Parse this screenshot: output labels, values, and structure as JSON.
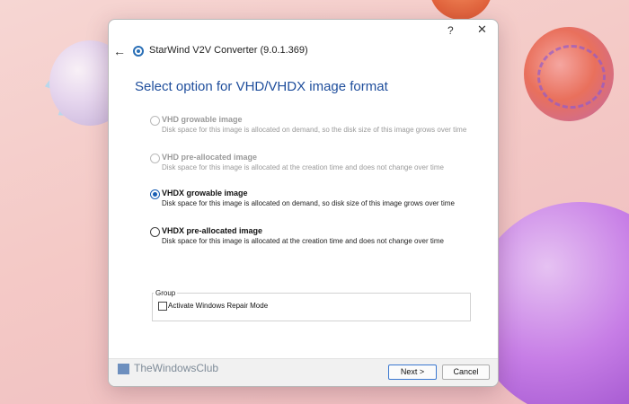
{
  "window": {
    "title": "StarWind V2V Converter (9.0.1.369)",
    "help_label": "?",
    "close_label": "✕",
    "back_label": "←"
  },
  "heading": "Select option for VHD/VHDX image format",
  "options": [
    {
      "label": "VHD growable image",
      "description": "Disk space for this image is allocated on demand, so the disk size of this image grows over time",
      "state": "disabled"
    },
    {
      "label": "VHD pre-allocated image",
      "description": "Disk space for this image is allocated at the creation time and does not change over time",
      "state": "disabled"
    },
    {
      "label": "VHDX growable image",
      "description": "Disk space for this image is allocated on demand, so disk size of this image grows over time",
      "state": "checked"
    },
    {
      "label": "VHDX pre-allocated image",
      "description": "Disk space for this image is allocated at the creation time and does not change over time",
      "state": "unchecked"
    }
  ],
  "group": {
    "title": "Group",
    "checkbox_label": "Activate Windows Repair Mode",
    "checked": false
  },
  "footer": {
    "watermark": "TheWindowsClub",
    "next_label": "Next >",
    "cancel_label": "Cancel"
  },
  "colors": {
    "accent": "#1a5fb4",
    "heading": "#1f4e9c",
    "disabled_text": "#9a9a9a"
  }
}
